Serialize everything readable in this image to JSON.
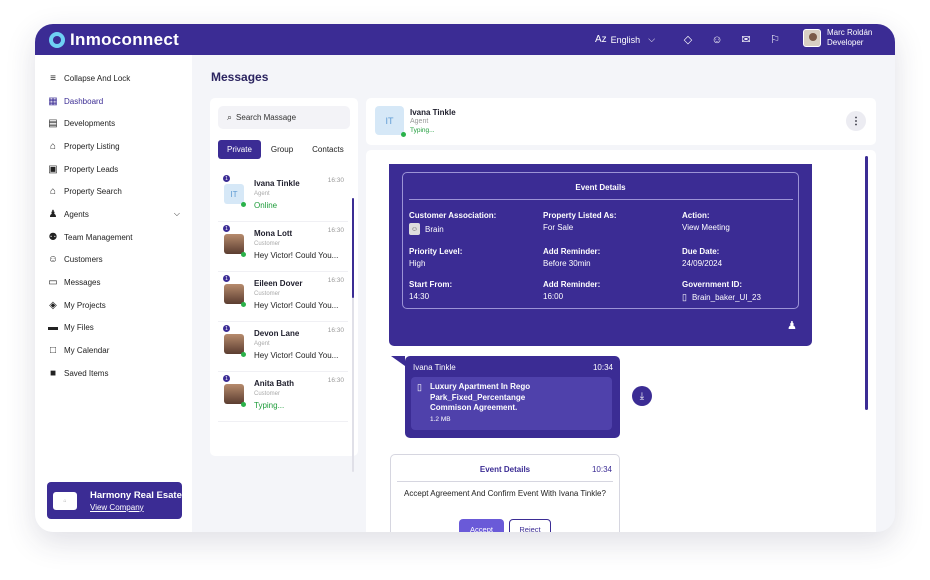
{
  "app": {
    "name": "Inmoconnect"
  },
  "topbar": {
    "language": "English",
    "user_name": "Marc Roldán",
    "user_role": "Developer"
  },
  "sidebar": {
    "items": [
      {
        "label": "Collapse And Lock",
        "icon": "collapse-icon"
      },
      {
        "label": "Dashboard",
        "icon": "dashboard-icon"
      },
      {
        "label": "Developments",
        "icon": "building-icon"
      },
      {
        "label": "Property Listing",
        "icon": "home-icon"
      },
      {
        "label": "Property Leads",
        "icon": "leads-icon"
      },
      {
        "label": "Property Search",
        "icon": "home-search-icon"
      },
      {
        "label": "Agents",
        "icon": "agents-icon"
      },
      {
        "label": "Team Management",
        "icon": "team-icon"
      },
      {
        "label": "Customers",
        "icon": "customers-icon"
      },
      {
        "label": "Messages",
        "icon": "messages-icon"
      },
      {
        "label": "My Projects",
        "icon": "layers-icon"
      },
      {
        "label": "My Files",
        "icon": "folder-icon"
      },
      {
        "label": "My Calendar",
        "icon": "calendar-icon"
      },
      {
        "label": "Saved Items",
        "icon": "save-icon"
      }
    ],
    "company": {
      "name": "Harmony Real Esate",
      "link": "View Company"
    }
  },
  "page": {
    "title": "Messages"
  },
  "contacts_panel": {
    "search_placeholder": "Search Massage",
    "tabs": [
      "Private",
      "Group",
      "Contacts"
    ],
    "contacts": [
      {
        "initials": "IT",
        "name": "Ivana Tinkle",
        "role": "Agent",
        "message": "Online",
        "time": "16:30",
        "badge": "1"
      },
      {
        "name": "Mona Lott",
        "role": "Customer",
        "message": "Hey Victor! Could You...",
        "time": "16:30",
        "badge": "1"
      },
      {
        "name": "Eileen Dover",
        "role": "Customer",
        "message": "Hey Victor! Could You...",
        "time": "16:30",
        "badge": "1"
      },
      {
        "name": "Devon Lane",
        "role": "Agent",
        "message": "Hey Victor! Could You...",
        "time": "16:30",
        "badge": "1"
      },
      {
        "name": "Anita Bath",
        "role": "Customer",
        "message": "Typing...",
        "time": "16:30",
        "badge": "1"
      }
    ]
  },
  "chat": {
    "header": {
      "initials": "IT",
      "name": "Ivana Tinkle",
      "role": "Agent",
      "status": "Typing..."
    },
    "event_details": {
      "title": "Event Details",
      "fields": [
        {
          "label": "Customer Association:",
          "value": "Brain"
        },
        {
          "label": "Property Listed As:",
          "value": "For Sale"
        },
        {
          "label": "Action:",
          "value": "View Meeting"
        },
        {
          "label": "Priority Level:",
          "value": "High"
        },
        {
          "label": "Add Reminder:",
          "value": "Before 30min"
        },
        {
          "label": "Due Date:",
          "value": "24/09/2024"
        },
        {
          "label": "Start From:",
          "value": "14:30"
        },
        {
          "label": "Add Reminder:",
          "value": "16:00"
        },
        {
          "label": "Government ID:",
          "value": "Brain_baker_UI_23"
        }
      ]
    },
    "file_message": {
      "sender": "Ivana Tinkle",
      "time": "10:34",
      "file_name": "Luxury Apartment In Rego Park_Fixed_Percentange Commison Agreement.",
      "file_size": "1.2 MB"
    },
    "event_request": {
      "title": "Event Details",
      "time": "10:34",
      "text": "Accept Agreement And Confirm Event With Ivana Tinkle?",
      "accept_label": "Accept",
      "reject_label": "Reject"
    }
  },
  "colors": {
    "brand": "#3b2c94",
    "online": "#2ab24a",
    "accent_light": "#6fd1f4"
  }
}
